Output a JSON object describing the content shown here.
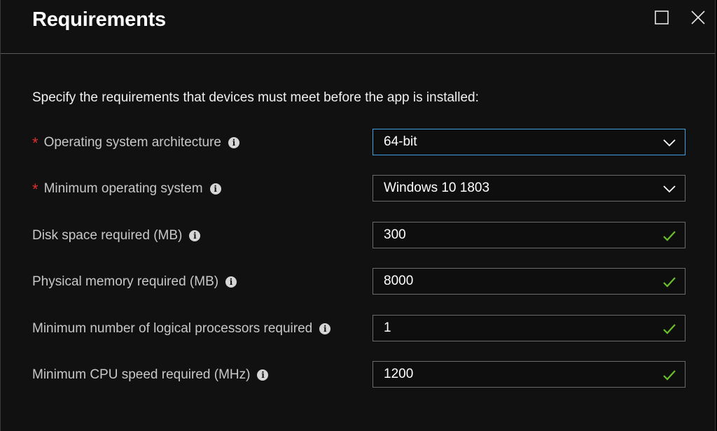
{
  "header": {
    "title": "Requirements",
    "maximize_icon": "maximize-icon",
    "close_icon": "close-icon"
  },
  "intro": "Specify the requirements that devices must meet before the app is installed:",
  "fields": [
    {
      "label": "Operating system architecture",
      "required": true,
      "value": "64-bit",
      "kind": "dropdown",
      "focused": true
    },
    {
      "label": "Minimum operating system",
      "required": true,
      "value": "Windows 10 1803",
      "kind": "dropdown",
      "focused": false
    },
    {
      "label": "Disk space required (MB)",
      "required": false,
      "value": "300",
      "kind": "text",
      "valid": true
    },
    {
      "label": "Physical memory required (MB)",
      "required": false,
      "value": "8000",
      "kind": "text",
      "valid": true
    },
    {
      "label": "Minimum number of logical processors required",
      "required": false,
      "value": "1",
      "kind": "text",
      "valid": true
    },
    {
      "label": "Minimum CPU speed required (MHz)",
      "required": false,
      "value": "1200",
      "kind": "text",
      "valid": true
    }
  ],
  "required_marker": "*",
  "info_glyph": "i",
  "colors": {
    "background": "#111111",
    "required_star": "#e02f2f",
    "focus_border": "#3f9fe0",
    "valid_check": "#6abf2a"
  }
}
